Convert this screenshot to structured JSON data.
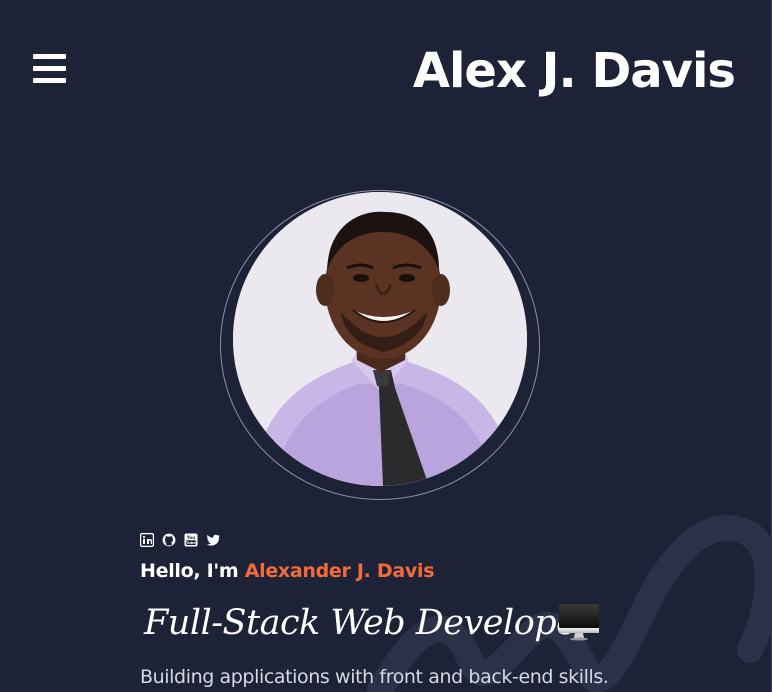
{
  "header": {
    "title": "Alex J. Davis",
    "menu_icon": "hamburger-menu-icon"
  },
  "hero": {
    "avatar_alt": "Portrait of Alexander J. Davis",
    "social_icons": [
      "linkedin-icon",
      "github-icon",
      "youtube-icon",
      "twitter-icon"
    ],
    "greeting": "Hello, I'm",
    "name": "Alexander J. Davis",
    "role": "Full-Stack Web Developer",
    "role_icon": "desktop-monitor-icon",
    "tagline": "Building applications with front and back-end skills."
  },
  "colors": {
    "background": "#1e2237",
    "accent": "#f26b3a",
    "text": "#ffffff",
    "muted_text": "#d6d8e4"
  }
}
